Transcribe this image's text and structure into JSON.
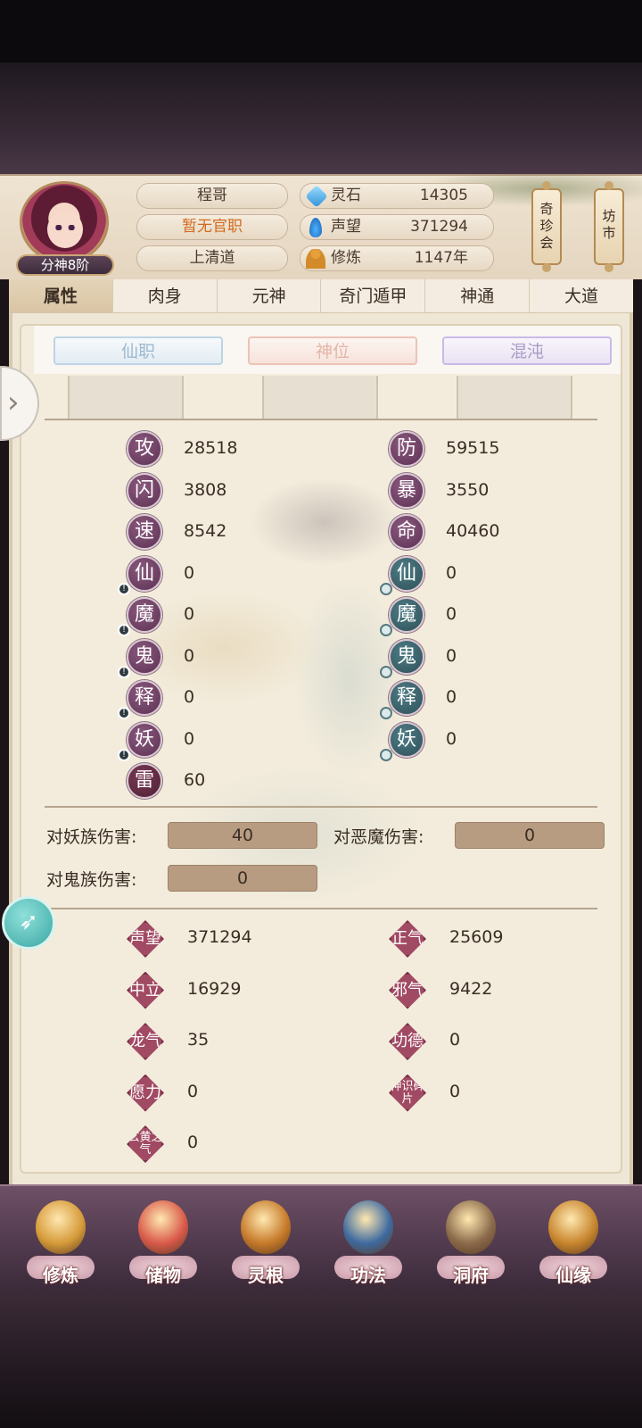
{
  "header": {
    "rank": "分神8阶",
    "name": "程哥",
    "official": "暂无官职",
    "sect": "上清道",
    "resources": [
      {
        "icon": "spirit-stone-icon",
        "label": "灵石",
        "value": "14305"
      },
      {
        "icon": "prestige-icon",
        "label": "声望",
        "value": "371294"
      },
      {
        "icon": "cultivation-icon",
        "label": "修炼",
        "value": "1147年"
      }
    ],
    "side_buttons": [
      "奇\n珍\n会",
      "坊\n市"
    ]
  },
  "tabs": [
    {
      "label": "属性",
      "active": true
    },
    {
      "label": "肉身",
      "active": false
    },
    {
      "label": "元神",
      "active": false
    },
    {
      "label": "奇门遁甲",
      "active": false
    },
    {
      "label": "神通",
      "active": false
    },
    {
      "label": "大道",
      "active": false
    }
  ],
  "titles": {
    "xianzhi": "仙职",
    "shenwei": "神位",
    "hundun": "混沌",
    "bracket": "【"
  },
  "stats_left": [
    {
      "glyph": "攻",
      "value": "28518",
      "mark": ""
    },
    {
      "glyph": "闪",
      "value": "3808",
      "mark": ""
    },
    {
      "glyph": "速",
      "value": "8542",
      "mark": ""
    },
    {
      "glyph": "仙",
      "value": "0",
      "mark": "!"
    },
    {
      "glyph": "魔",
      "value": "0",
      "mark": "!"
    },
    {
      "glyph": "鬼",
      "value": "0",
      "mark": "!"
    },
    {
      "glyph": "释",
      "value": "0",
      "mark": "!"
    },
    {
      "glyph": "妖",
      "value": "0",
      "mark": "!"
    },
    {
      "glyph": "雷",
      "value": "60",
      "mark": ""
    }
  ],
  "stats_right": [
    {
      "glyph": "防",
      "value": "59515",
      "mark": ""
    },
    {
      "glyph": "暴",
      "value": "3550",
      "mark": ""
    },
    {
      "glyph": "命",
      "value": "40460",
      "mark": ""
    },
    {
      "glyph": "仙",
      "value": "0",
      "mark": "o"
    },
    {
      "glyph": "魔",
      "value": "0",
      "mark": "o"
    },
    {
      "glyph": "鬼",
      "value": "0",
      "mark": "o"
    },
    {
      "glyph": "释",
      "value": "0",
      "mark": "o"
    },
    {
      "glyph": "妖",
      "value": "0",
      "mark": "o"
    }
  ],
  "damage": {
    "vs_yao_label": "对妖族伤害:",
    "vs_yao": "40",
    "vs_emo_label": "对恶魔伤害:",
    "vs_emo": "0",
    "vs_gui_label": "对鬼族伤害:",
    "vs_gui": "0"
  },
  "reputation_left": [
    {
      "label": "声望",
      "value": "371294"
    },
    {
      "label": "中立",
      "value": "16929"
    },
    {
      "label": "龙气",
      "value": "35"
    },
    {
      "label": "愿力",
      "value": "0"
    },
    {
      "label": "玄黄之气",
      "value": "0"
    }
  ],
  "reputation_right": [
    {
      "label": "正气",
      "value": "25609"
    },
    {
      "label": "邪气",
      "value": "9422"
    },
    {
      "label": "功德",
      "value": "0"
    },
    {
      "label": "神识碎片",
      "value": "0"
    }
  ],
  "nav": [
    {
      "label": "修炼",
      "icon": "monk-icon",
      "color": "#d69b3a"
    },
    {
      "label": "储物",
      "icon": "pouch-icon",
      "color": "#d95a4a"
    },
    {
      "label": "灵根",
      "icon": "spirit-root-icon",
      "color": "#c67a2a"
    },
    {
      "label": "功法",
      "icon": "book-icon",
      "color": "#3e6aa0"
    },
    {
      "label": "洞府",
      "icon": "pavilion-icon",
      "color": "#8a6a4a"
    },
    {
      "label": "仙缘",
      "icon": "gourd-icon",
      "color": "#c8862e"
    }
  ]
}
